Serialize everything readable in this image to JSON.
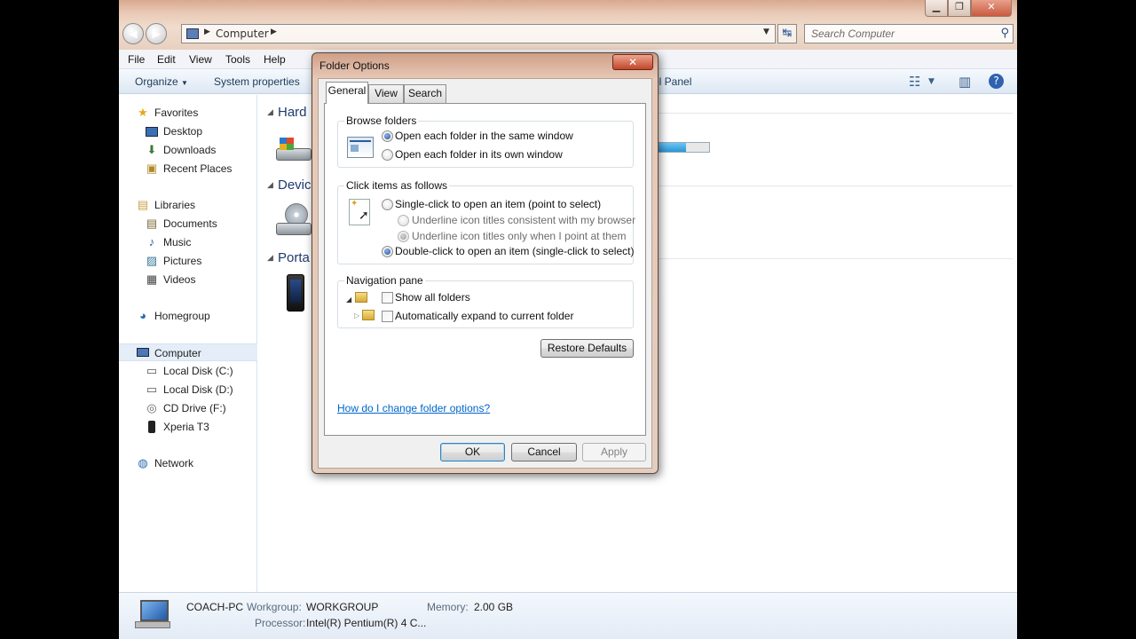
{
  "explorer": {
    "address": {
      "location": "Computer"
    },
    "search": {
      "placeholder": "Search Computer"
    },
    "menu": [
      "File",
      "Edit",
      "View",
      "Tools",
      "Help"
    ],
    "command_bar": {
      "organize": "Organize",
      "system_properties": "System properties",
      "control_panel_fragment": "ol Panel"
    },
    "nav": {
      "favorites": "Favorites",
      "desktop": "Desktop",
      "downloads": "Downloads",
      "recent_places": "Recent Places",
      "libraries": "Libraries",
      "documents": "Documents",
      "music": "Music",
      "pictures": "Pictures",
      "videos": "Videos",
      "homegroup": "Homegroup",
      "computer": "Computer",
      "local_disk_c": "Local Disk (C:)",
      "local_disk_d": "Local Disk (D:)",
      "cd_drive": "CD Drive (F:)",
      "xperia": "Xperia T3",
      "network": "Network"
    },
    "groups": {
      "hard": "Hard",
      "devices": "Device",
      "portable": "Porta"
    },
    "drive_usage_fraction": 0.55,
    "details": {
      "pc_name": "COACH-PC",
      "workgroup_label": "Workgroup:",
      "workgroup_value": "WORKGROUP",
      "memory_label": "Memory:",
      "memory_value": "2.00 GB",
      "processor_label": "Processor:",
      "processor_value": "Intel(R) Pentium(R) 4 C..."
    }
  },
  "dialog": {
    "title": "Folder Options",
    "tabs": {
      "general": "General",
      "view": "View",
      "search": "Search"
    },
    "browse": {
      "title": "Browse folders",
      "same_window": "Open each folder in the same window",
      "own_window": "Open each folder in its own window"
    },
    "click": {
      "title": "Click items as follows",
      "single": "Single-click to open an item (point to select)",
      "underline_browser": "Underline icon titles consistent with my browser",
      "underline_point": "Underline icon titles only when I point at them",
      "double": "Double-click to open an item (single-click to select)"
    },
    "nav_pane": {
      "title": "Navigation pane",
      "show_all": "Show all folders",
      "auto_expand": "Automatically expand to current folder"
    },
    "restore_defaults": "Restore Defaults",
    "help_link": "How do I change folder options?",
    "ok": "OK",
    "cancel": "Cancel",
    "apply": "Apply"
  }
}
